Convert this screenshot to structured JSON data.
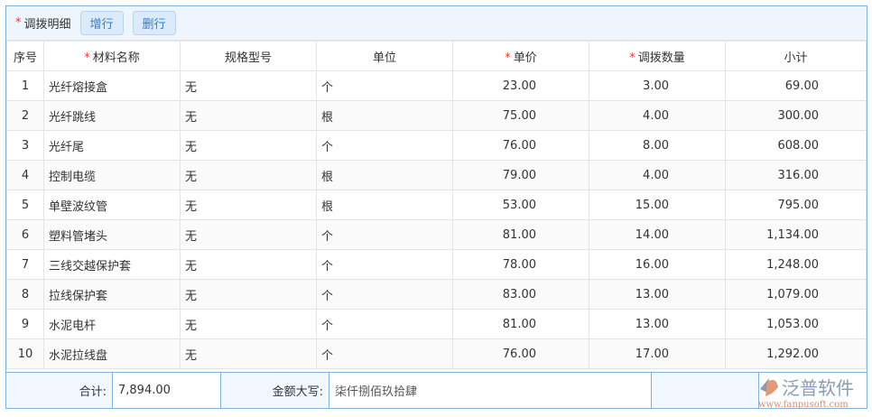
{
  "header": {
    "title": "调拨明细",
    "add_row": "增行",
    "delete_row": "删行"
  },
  "columns": [
    "序号",
    "材料名称",
    "规格型号",
    "单位",
    "单价",
    "调拨数量",
    "小计"
  ],
  "rows": [
    [
      "1",
      "光纤熔接盒",
      "无",
      "个",
      "23.00",
      "3.00",
      "69.00"
    ],
    [
      "2",
      "光纤跳线",
      "无",
      "根",
      "75.00",
      "4.00",
      "300.00"
    ],
    [
      "3",
      "光纤尾",
      "无",
      "个",
      "76.00",
      "8.00",
      "608.00"
    ],
    [
      "4",
      "控制电缆",
      "无",
      "根",
      "79.00",
      "4.00",
      "316.00"
    ],
    [
      "5",
      "单壁波纹管",
      "无",
      "根",
      "53.00",
      "15.00",
      "795.00"
    ],
    [
      "6",
      "塑料管堵头",
      "无",
      "个",
      "81.00",
      "14.00",
      "1,134.00"
    ],
    [
      "7",
      "三线交越保护套",
      "无",
      "个",
      "78.00",
      "16.00",
      "1,248.00"
    ],
    [
      "8",
      "拉线保护套",
      "无",
      "个",
      "83.00",
      "13.00",
      "1,079.00"
    ],
    [
      "9",
      "水泥电杆",
      "无",
      "个",
      "81.00",
      "13.00",
      "1,053.00"
    ],
    [
      "10",
      "水泥拉线盘",
      "无",
      "个",
      "76.00",
      "17.00",
      "1,292.00"
    ]
  ],
  "footer": {
    "total_label": "合计:",
    "total_value": "7,894.00",
    "amount_words_label": "金额大写:",
    "amount_words_value": "柒仟捌佰玖拾肆"
  },
  "logo": {
    "name": "泛普软件",
    "url": "www.fanpusoft.com"
  }
}
